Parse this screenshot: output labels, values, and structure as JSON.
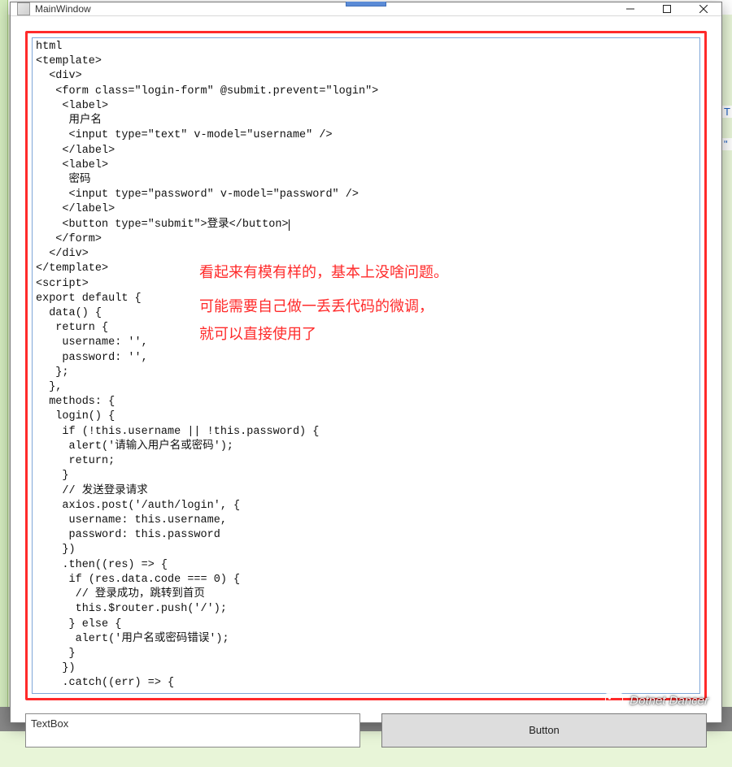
{
  "window": {
    "title": "MainWindow"
  },
  "code_lines": [
    "html",
    "<template>",
    "  <div>",
    "   <form class=\"login-form\" @submit.prevent=\"login\">",
    "    <label>",
    "     用户名",
    "     <input type=\"text\" v-model=\"username\" />",
    "    </label>",
    "    <label>",
    "     密码",
    "     <input type=\"password\" v-model=\"password\" />",
    "    </label>",
    "    <button type=\"submit\">登录</button>",
    "   </form>",
    "  </div>",
    "</template>",
    "",
    "<script>",
    "export default {",
    "  data() {",
    "   return {",
    "    username: '',",
    "    password: '',",
    "   };",
    "  },",
    "  methods: {",
    "   login() {",
    "    if (!this.username || !this.password) {",
    "     alert('请输入用户名或密码');",
    "     return;",
    "    }",
    "",
    "    // 发送登录请求",
    "    axios.post('/auth/login', {",
    "     username: this.username,",
    "     password: this.password",
    "    })",
    "    .then((res) => {",
    "     if (res.data.code === 0) {",
    "      // 登录成功，跳转到首页",
    "      this.$router.push('/');",
    "     } else {",
    "      alert('用户名或密码错误');",
    "     }",
    "    })",
    "    .catch((err) => {"
  ],
  "caret_line_index": 12,
  "annotations": {
    "line1": "看起来有模有样的，基本上没啥问题。",
    "line2": "可能需要自己做一丢丢代码的微调，\n就可以直接使用了"
  },
  "bottom": {
    "textbox_value": "TextBox",
    "button_label": "Button"
  },
  "watermark": "Dotnet Dancer",
  "bg_fragments": {
    "t": "T",
    "quote": "\""
  }
}
